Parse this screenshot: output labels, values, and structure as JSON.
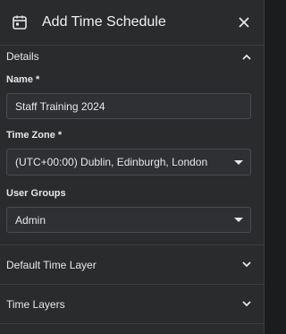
{
  "header": {
    "title": "Add Time Schedule",
    "icon": "calendar-icon",
    "close_icon": "close-icon"
  },
  "sections": {
    "details": {
      "label": "Details",
      "expanded": true
    },
    "default_time_layer": {
      "label": "Default Time Layer",
      "expanded": false
    },
    "time_layers": {
      "label": "Time Layers",
      "expanded": false
    }
  },
  "form": {
    "name": {
      "label": "Name *",
      "value": "Staff Training 2024"
    },
    "time_zone": {
      "label": "Time Zone *",
      "value": "(UTC+00:00) Dublin, Edinburgh, London"
    },
    "user_groups": {
      "label": "User Groups",
      "value": "Admin"
    }
  },
  "colors": {
    "panel_bg": "#2a2b2d",
    "input_bg": "#2f3033",
    "border": "#4a4b4e",
    "text": "#e6e6e6"
  }
}
